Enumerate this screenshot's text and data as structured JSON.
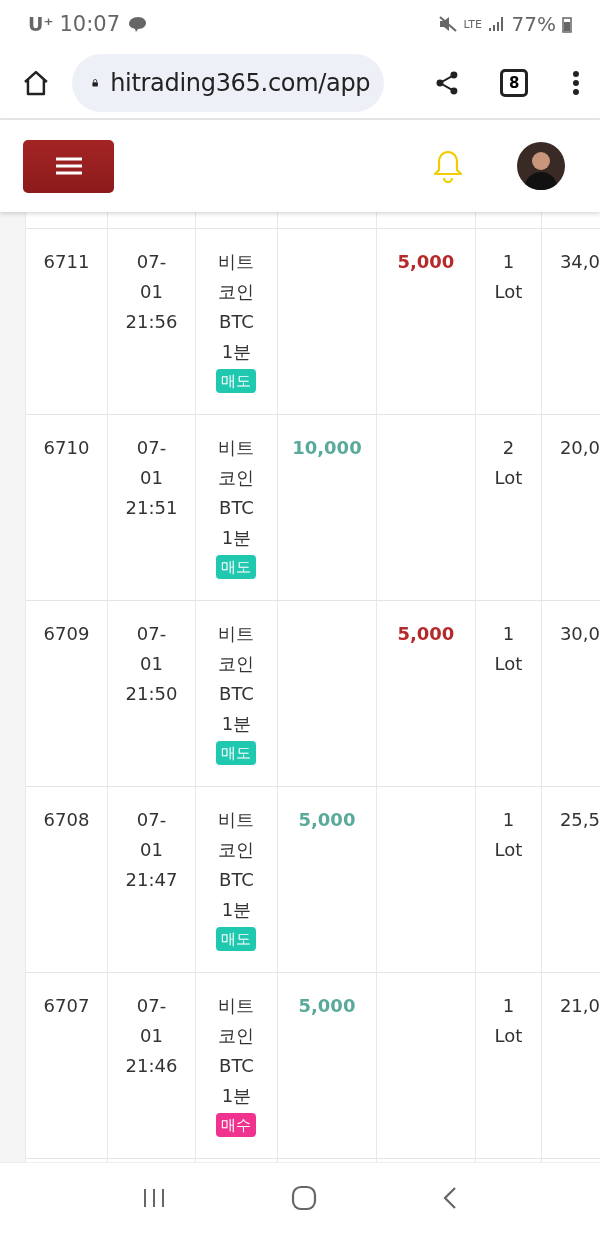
{
  "status_bar": {
    "carrier": "U⁺",
    "time": "10:07",
    "network": "LTE",
    "battery": "77%"
  },
  "browser": {
    "url": "hitrading365.com/app",
    "tab_count": "8"
  },
  "rows": [
    {
      "id": "6711",
      "date": "07-",
      "date2": "01",
      "time": "21:56",
      "symbol": [
        "비트",
        "코인",
        "BTC",
        "1분"
      ],
      "side": {
        "label": "매도",
        "kind": "sell"
      },
      "column_5": "5,000",
      "lots": "1",
      "unit": "Lot",
      "column_8": "34,0"
    },
    {
      "id": "6710",
      "date": "07-",
      "date2": "01",
      "time": "21:51",
      "symbol": [
        "비트",
        "코인",
        "BTC",
        "1분"
      ],
      "side": {
        "label": "매도",
        "kind": "sell"
      },
      "column_4": "10,000",
      "lots": "2",
      "unit": "Lot",
      "column_8": "20,0"
    },
    {
      "id": "6709",
      "date": "07-",
      "date2": "01",
      "time": "21:50",
      "symbol": [
        "비트",
        "코인",
        "BTC",
        "1분"
      ],
      "side": {
        "label": "매도",
        "kind": "sell"
      },
      "column_5": "5,000",
      "lots": "1",
      "unit": "Lot",
      "column_8": "30,0"
    },
    {
      "id": "6708",
      "date": "07-",
      "date2": "01",
      "time": "21:47",
      "symbol": [
        "비트",
        "코인",
        "BTC",
        "1분"
      ],
      "side": {
        "label": "매도",
        "kind": "sell"
      },
      "column_4": "5,000",
      "lots": "1",
      "unit": "Lot",
      "column_8": "25,5"
    },
    {
      "id": "6707",
      "date": "07-",
      "date2": "01",
      "time": "21:46",
      "symbol": [
        "비트",
        "코인",
        "BTC",
        "1분"
      ],
      "side": {
        "label": "매수",
        "kind": "buy"
      },
      "column_4": "5,000",
      "lots": "1",
      "unit": "Lot",
      "column_8": "21,0"
    }
  ]
}
